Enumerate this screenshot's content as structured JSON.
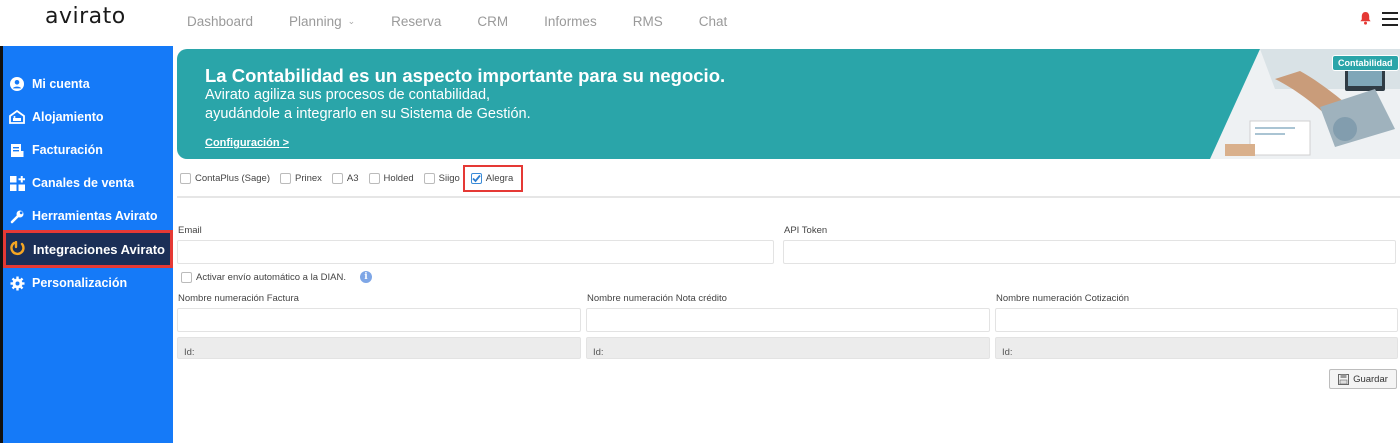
{
  "app": {
    "logo": "avirato"
  },
  "nav": {
    "items": [
      "Dashboard",
      "Planning",
      "Reserva",
      "CRM",
      "Informes",
      "RMS",
      "Chat"
    ],
    "planning_chevron": "⌄"
  },
  "sidebar": {
    "items": [
      {
        "label": "Mi cuenta",
        "icon": "user-icon"
      },
      {
        "label": "Alojamiento",
        "icon": "hotel-icon"
      },
      {
        "label": "Facturación",
        "icon": "invoice-icon"
      },
      {
        "label": "Canales de venta",
        "icon": "grid-icon"
      },
      {
        "label": "Herramientas Avirato",
        "icon": "wrench-icon"
      },
      {
        "label": "Integraciones Avirato",
        "icon": "integration-icon",
        "active": true
      },
      {
        "label": "Personalización",
        "icon": "gear-icon"
      }
    ]
  },
  "banner": {
    "title": "La Contabilidad es un aspecto importante para su negocio.",
    "subtitle_line1": "Avirato agiliza sus procesos de contabilidad,",
    "subtitle_line2": "ayudándole a integrarlo en su Sistema de Gestión.",
    "link": "Configuración >",
    "badge": "Contabilidad"
  },
  "accounting_options": [
    {
      "label": "ContaPlus (Sage)",
      "checked": false
    },
    {
      "label": "Prinex",
      "checked": false
    },
    {
      "label": "A3",
      "checked": false
    },
    {
      "label": "Holded",
      "checked": false
    },
    {
      "label": "Siigo",
      "checked": false
    },
    {
      "label": "Alegra",
      "checked": true
    }
  ],
  "form": {
    "email_label": "Email",
    "email_value": "",
    "token_label": "API Token",
    "token_value": "",
    "dian_label": "Activar envío automático a la DIAN.",
    "dian_checked": false,
    "info_glyph": "i",
    "factura_label": "Nombre numeración Factura",
    "nota_label": "Nombre numeración Nota crédito",
    "cotizacion_label": "Nombre numeración Cotización",
    "id_text": "Id:",
    "save_label": "Guardar"
  },
  "colors": {
    "sidebar": "#157af8",
    "sidebar_active": "#1b2f57",
    "highlight": "#e53935",
    "banner": "#2aa5a9"
  }
}
